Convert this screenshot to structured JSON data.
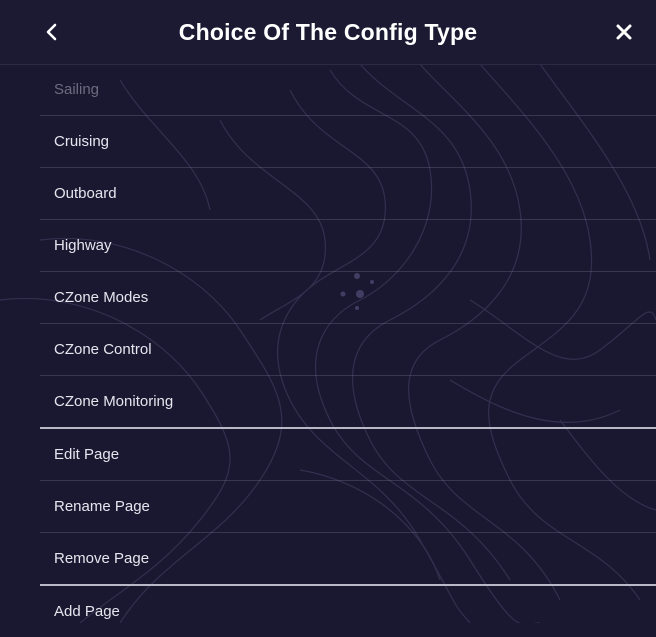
{
  "header": {
    "title": "Choice Of The Config Type",
    "back_icon": "chevron-left-icon",
    "close_icon": "close-icon"
  },
  "items": [
    {
      "label": "Sailing",
      "enabled": false
    },
    {
      "label": "Cruising",
      "enabled": true
    },
    {
      "label": "Outboard",
      "enabled": true
    },
    {
      "label": "Highway",
      "enabled": true
    },
    {
      "label": "CZone Modes",
      "enabled": true
    },
    {
      "label": "CZone Control",
      "enabled": true
    },
    {
      "label": "CZone Monitoring",
      "enabled": true
    },
    {
      "label": "Edit Page",
      "enabled": true
    },
    {
      "label": "Rename Page",
      "enabled": true
    },
    {
      "label": "Remove Page",
      "enabled": true
    },
    {
      "label": "Add Page",
      "enabled": true
    }
  ],
  "colors": {
    "background": "#1a1830",
    "header_background": "#1c1a33",
    "text": "#e6e5ee",
    "disabled_text": "#6d6b80",
    "divider": "#b9b8c6"
  }
}
